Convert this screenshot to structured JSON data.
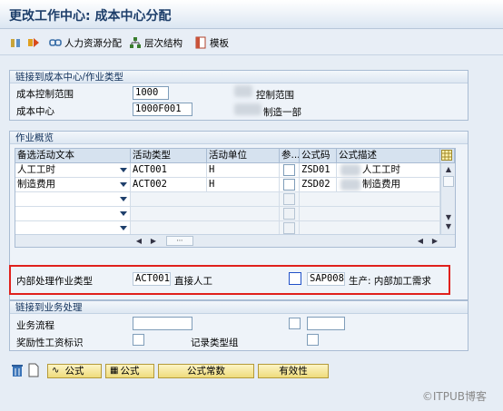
{
  "window": {
    "title": "更改工作中心: 成本中心分配"
  },
  "toolbar": {
    "hr_label": "人力资源分配",
    "hier_label": "层次结构",
    "template_label": "模板"
  },
  "link_group": {
    "title": "链接到成本中心/作业类型",
    "controlling_area_label": "成本控制范围",
    "controlling_area_value": "1000",
    "controlling_area_desc": "控制范围",
    "cost_center_label": "成本中心",
    "cost_center_value": "1000F001",
    "cost_center_desc": "制造一部"
  },
  "activity": {
    "title": "作业概览",
    "headers": [
      "备选活动文本",
      "活动类型",
      "活动单位",
      "参...",
      "公式码",
      "公式描述"
    ],
    "rows": [
      {
        "text": "人工工时",
        "type": "ACT001",
        "unit": "H",
        "formula": "ZSD01",
        "formula_desc": "人工工时"
      },
      {
        "text": "制造费用",
        "type": "ACT002",
        "unit": "H",
        "formula": "ZSD02",
        "formula_desc": "制造费用"
      }
    ]
  },
  "internal": {
    "label": "内部处理作业类型",
    "type_value": "ACT001",
    "type_desc": "直接人工",
    "formula_value": "SAP008",
    "formula_desc": "生产: 内部加工需求"
  },
  "business": {
    "title": "链接到业务处理",
    "process_label": "业务流程",
    "incentive_label": "奖励性工资标识",
    "record_label": "记录类型组"
  },
  "buttons": {
    "formula1": "公式",
    "formula2": "公式",
    "formula_const": "公式常数",
    "validity": "有效性"
  },
  "watermark": "©ITPUB博客"
}
